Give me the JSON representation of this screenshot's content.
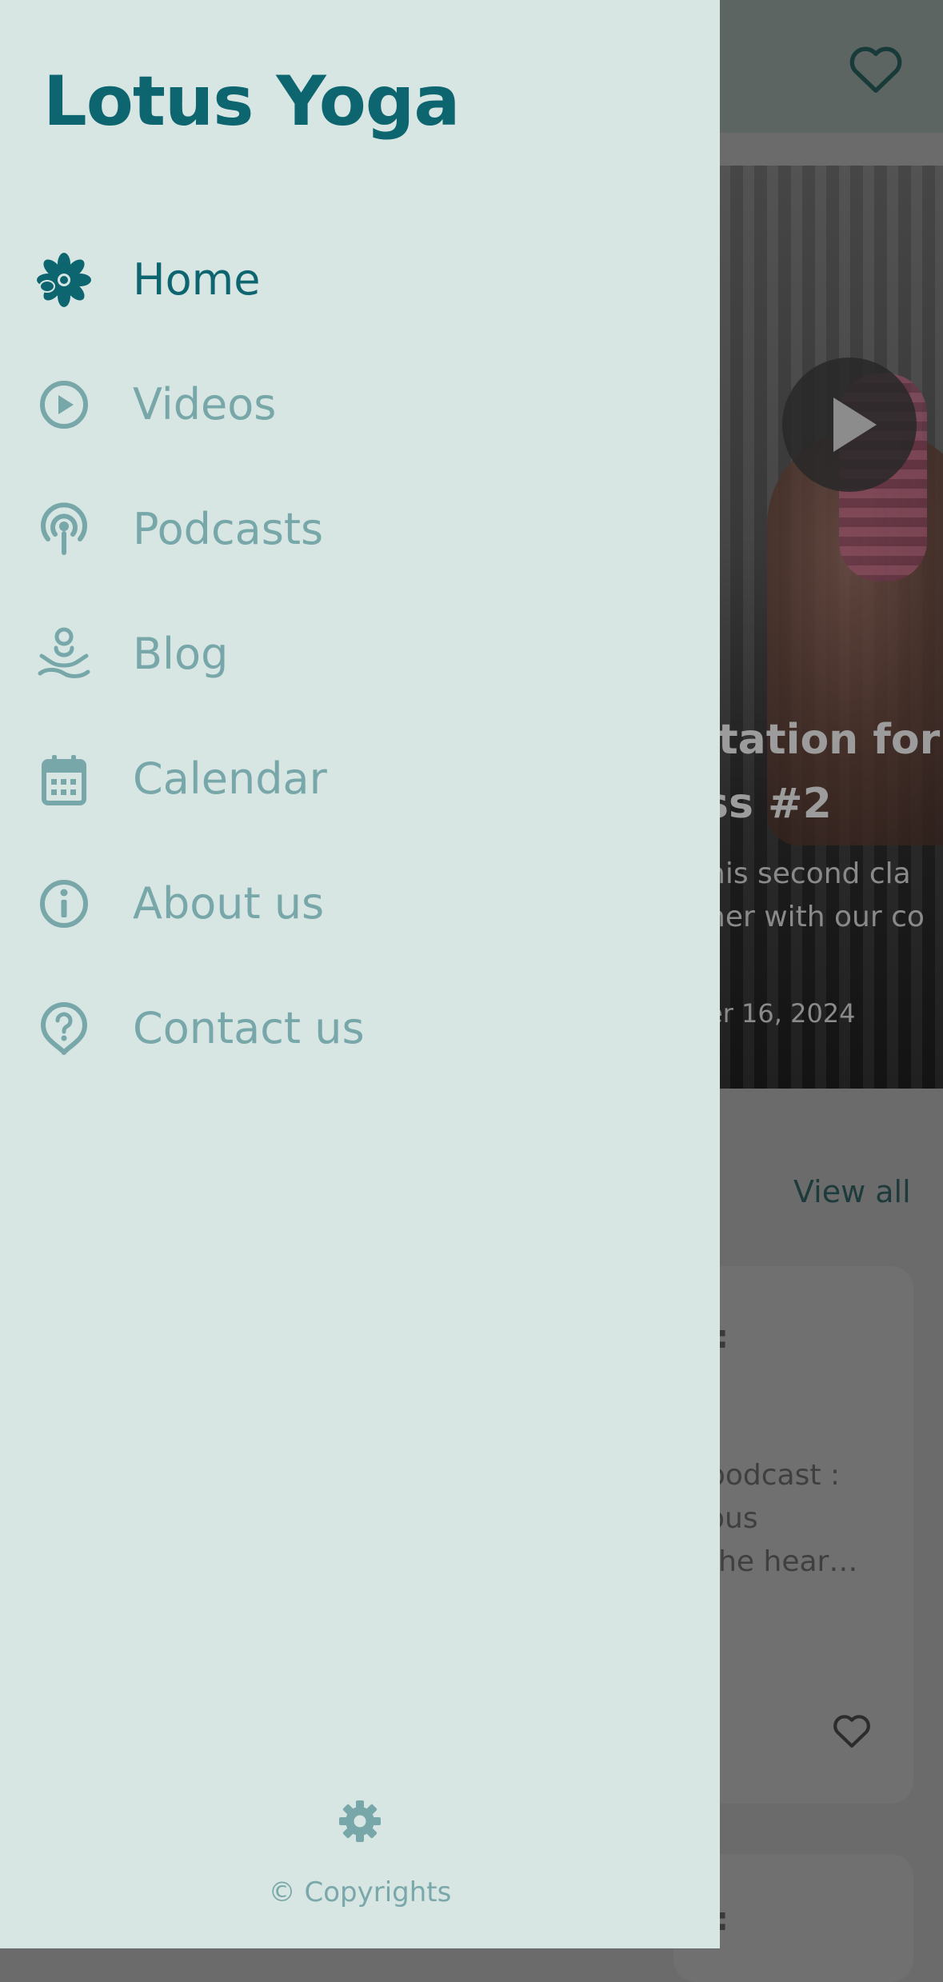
{
  "app": {
    "title": "Lotus Yoga"
  },
  "colors": {
    "accent": "#0d6570",
    "muted": "#78a7a9",
    "drawer_bg": "#d7e6e3",
    "scrim": "#6b6b6b"
  },
  "menu": {
    "items": [
      {
        "id": "home",
        "label": "Home",
        "icon": "flower-icon",
        "active": true
      },
      {
        "id": "videos",
        "label": "Videos",
        "icon": "play-circle-icon",
        "active": false
      },
      {
        "id": "podcasts",
        "label": "Podcasts",
        "icon": "podcast-icon",
        "active": false
      },
      {
        "id": "blog",
        "label": "Blog",
        "icon": "meditation-icon",
        "active": false
      },
      {
        "id": "calendar",
        "label": "Calendar",
        "icon": "calendar-icon",
        "active": false
      },
      {
        "id": "about",
        "label": "About us",
        "icon": "info-icon",
        "active": false
      },
      {
        "id": "contact",
        "label": "Contact us",
        "icon": "question-bubble-icon",
        "active": false
      }
    ]
  },
  "footer": {
    "settings_icon": "gear-icon",
    "copyright": "© Copyrights"
  },
  "background": {
    "hero_title": "itation for\nss #2",
    "hero_desc": "his second cla\nher with our co",
    "hero_date": "er 16, 2024",
    "view_all": "View all",
    "card_dots": ":",
    "card_text": "podcast :\nous\n the hear…"
  }
}
